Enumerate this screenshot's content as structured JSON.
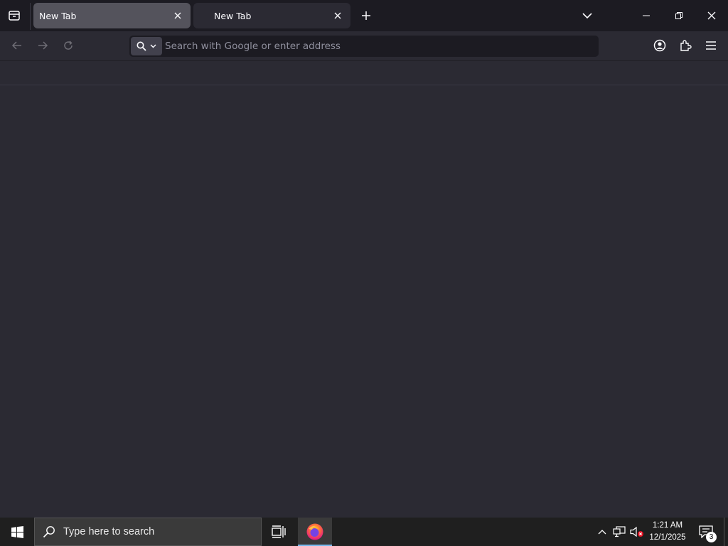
{
  "browser": {
    "tabs": [
      {
        "title": "New Tab",
        "active": true
      },
      {
        "title": "New Tab",
        "active": false
      }
    ],
    "url_bar": {
      "placeholder": "Search with Google or enter address",
      "value": ""
    }
  },
  "taskbar": {
    "search_placeholder": "Type here to search",
    "clock_time": "1:21 AM",
    "clock_date": "12/1/2025",
    "notification_count": "3"
  },
  "colors": {
    "tab_active": "#54535c",
    "toolbar": "#2b2a33",
    "tabstrip": "#1c1b22",
    "taskbar": "#1f1f1f",
    "accent": "#76b9ed"
  }
}
